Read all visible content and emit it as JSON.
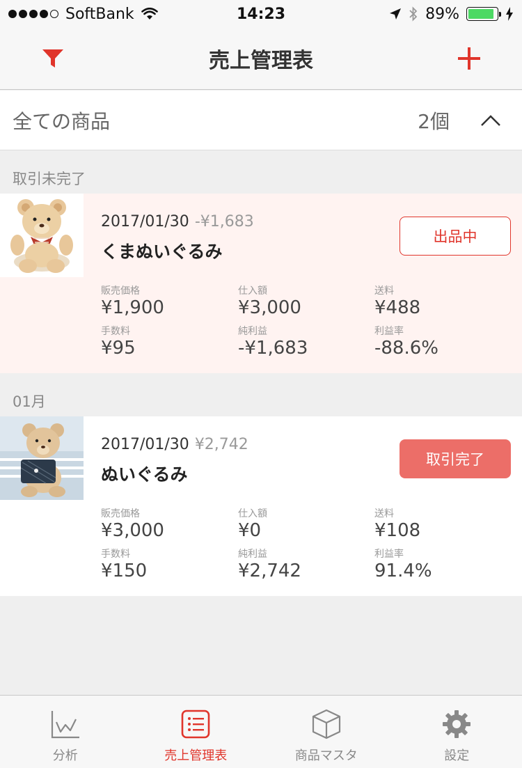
{
  "status_bar": {
    "carrier": "SoftBank",
    "time": "14:23",
    "battery": "89%",
    "battery_level": 0.89
  },
  "nav": {
    "title": "売上管理表"
  },
  "filter": {
    "label": "全ての商品",
    "count": "2個"
  },
  "sections": [
    {
      "header": "取引未完了",
      "item": {
        "date": "2017/01/30",
        "profit": "-¥1,683",
        "name": "くまぬいぐるみ",
        "status": "出品中",
        "stats": [
          {
            "label": "販売価格",
            "value": "¥1,900"
          },
          {
            "label": "仕入額",
            "value": "¥3,000"
          },
          {
            "label": "送料",
            "value": "¥488"
          },
          {
            "label": "手数料",
            "value": "¥95"
          },
          {
            "label": "純利益",
            "value": "-¥1,683"
          },
          {
            "label": "利益率",
            "value": "-88.6%"
          }
        ]
      }
    },
    {
      "header": "01月",
      "item": {
        "date": "2017/01/30",
        "profit": "¥2,742",
        "name": "ぬいぐるみ",
        "status": "取引完了",
        "stats": [
          {
            "label": "販売価格",
            "value": "¥3,000"
          },
          {
            "label": "仕入額",
            "value": "¥0"
          },
          {
            "label": "送料",
            "value": "¥108"
          },
          {
            "label": "手数料",
            "value": "¥150"
          },
          {
            "label": "純利益",
            "value": "¥2,742"
          },
          {
            "label": "利益率",
            "value": "91.4%"
          }
        ]
      }
    }
  ],
  "tabs": [
    {
      "label": "分析",
      "icon": "chart-icon"
    },
    {
      "label": "売上管理表",
      "icon": "list-icon"
    },
    {
      "label": "商品マスタ",
      "icon": "box-icon"
    },
    {
      "label": "設定",
      "icon": "gear-icon"
    }
  ],
  "colors": {
    "accent": "#e0352b",
    "pending_bg": "#fff3f1",
    "done_button": "#ec6e68"
  }
}
